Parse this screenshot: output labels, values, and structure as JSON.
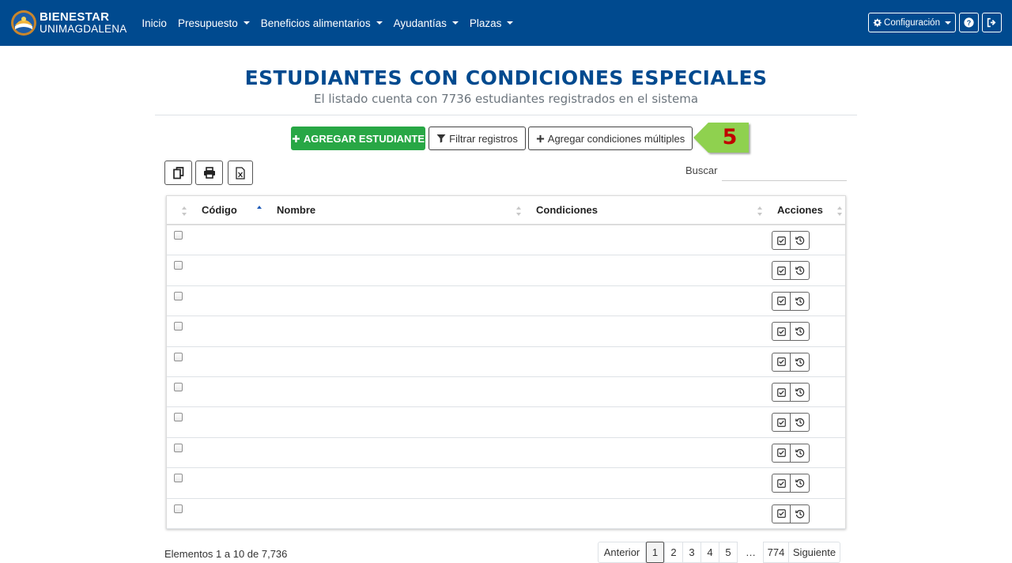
{
  "navbar": {
    "brand_line1": "BIENESTAR",
    "brand_line2": "UNIMAGDALENA",
    "items": [
      {
        "label": "Inicio",
        "dropdown": false
      },
      {
        "label": "Presupuesto",
        "dropdown": true
      },
      {
        "label": "Beneficios alimentarios",
        "dropdown": true
      },
      {
        "label": "Ayudantías",
        "dropdown": true
      },
      {
        "label": "Plazas",
        "dropdown": true
      }
    ],
    "config_label": "Configuración",
    "help_icon": "question-circle-icon",
    "logout_icon": "sign-out-icon",
    "bg_color": "#004a8f"
  },
  "header": {
    "title": "ESTUDIANTES CON CONDICIONES ESPECIALES",
    "subtitle": "El listado cuenta con 7736 estudiantes registrados en el sistema"
  },
  "actions": {
    "add_student": "AGREGAR ESTUDIANTE",
    "filter": "Filtrar registros",
    "add_multiple": "Agregar condiciones múltiples",
    "callout_number": "5",
    "add_color": "#28a745",
    "callout_color": "#8fd14f"
  },
  "tools": {
    "copy_icon": "copy-icon",
    "print_icon": "print-icon",
    "excel_icon": "excel-file-icon",
    "search_label": "Buscar",
    "search_value": ""
  },
  "table": {
    "columns": [
      "Código",
      "Nombre",
      "Condiciones",
      "Acciones"
    ],
    "sorted_column": "Código",
    "row_count": 10,
    "row_action_icons": [
      "check-square-icon",
      "history-icon"
    ]
  },
  "footer": {
    "info": "Elementos 1 a 10 de 7,736",
    "pagination": {
      "previous": "Anterior",
      "pages": [
        "1",
        "2",
        "3",
        "4",
        "5"
      ],
      "ellipsis": "…",
      "last_page": "774",
      "next": "Siguiente",
      "active_page": "1"
    }
  }
}
